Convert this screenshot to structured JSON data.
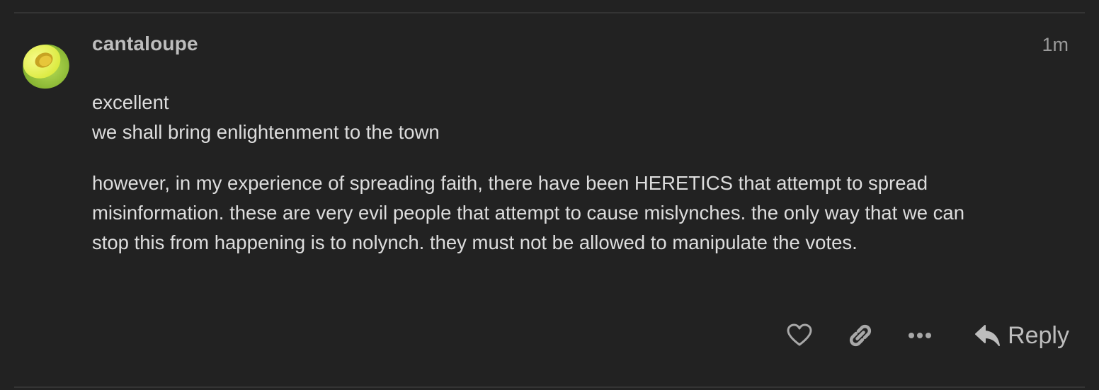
{
  "post": {
    "username": "cantaloupe",
    "time": "1m",
    "paragraphs": [
      {
        "lines": [
          "excellent",
          "we shall bring enlightenment to the town"
        ]
      },
      {
        "lines": [
          "however, in my experience of spreading faith, there have been HERETICS that attempt to spread",
          "misinformation. these are very evil people that attempt to cause mislynches. the only way that we can",
          "stop this from happening is to nolynch. they must not be allowed to manipulate the votes."
        ]
      }
    ]
  },
  "actions": {
    "like_icon": "heart-icon",
    "link_icon": "link-icon",
    "more_icon": "ellipsis-icon",
    "reply_icon": "reply-arrow-icon",
    "reply_label": "Reply"
  },
  "colors": {
    "background": "#222222",
    "text": "#dddddd",
    "muted": "#9a9a9a",
    "avatar_rind": "#a4d146",
    "avatar_flesh": "#e9f25a"
  }
}
